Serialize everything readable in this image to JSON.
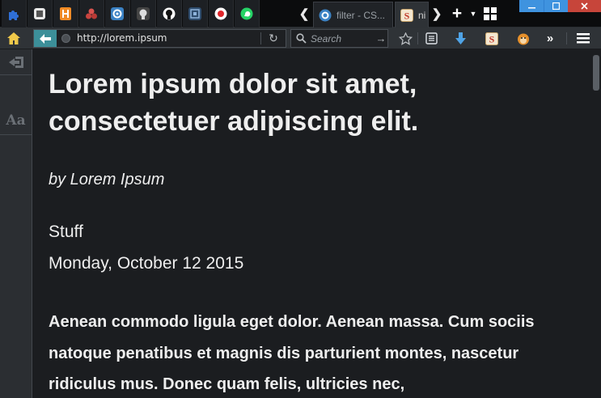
{
  "tabs": [
    {
      "label": "filter - CS..."
    },
    {
      "label": "ni"
    }
  ],
  "pinned_tabs": [
    {
      "icon": "puzzle-icon",
      "color": "#2f6fd6"
    },
    {
      "icon": "frame-icon",
      "color": "#e8e8e8"
    },
    {
      "icon": "h-badge-icon",
      "color": "#f08a24",
      "text": "H"
    },
    {
      "icon": "triple-circle-icon",
      "color": "#d9534f"
    },
    {
      "icon": "chrome-like-icon",
      "color": "#3b82c4"
    },
    {
      "icon": "github-icon",
      "color": "#dddddd"
    },
    {
      "icon": "github-icon",
      "color": "#ffffff"
    },
    {
      "icon": "shield-icon",
      "color": "#4a7fb5"
    },
    {
      "icon": "record-icon",
      "color": "#e0262b"
    },
    {
      "icon": "whatsapp-icon",
      "color": "#25d366"
    }
  ],
  "navbar": {
    "url": "http://lorem.ipsum",
    "search_placeholder": "Search"
  },
  "article": {
    "title": "Lorem ipsum dolor sit amet, consectetuer adipiscing elit.",
    "byline": "by Lorem Ipsum",
    "site": "Stuff",
    "date": "Monday, October 12 2015",
    "body": "Aenean commodo ligula eget dolor. Aenean massa. Cum sociis natoque penatibus et magnis dis parturient montes, nascetur ridiculus mus. Donec quam felis, ultricies nec,"
  },
  "reader": {
    "typography_label": "Aa"
  },
  "colors": {
    "background": "#1b1d20",
    "text": "#eeeeee",
    "accent": "#3c8f99",
    "close": "#c7453a",
    "window_controls": "#3f93df"
  }
}
